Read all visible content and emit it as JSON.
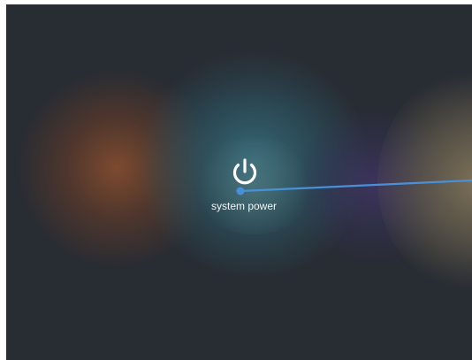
{
  "power_option": {
    "label": "system power",
    "icon": "power-icon"
  },
  "colors": {
    "background": "#282c33",
    "pointer_line": "#4a90d9",
    "label_text": "#f2f4f5"
  }
}
